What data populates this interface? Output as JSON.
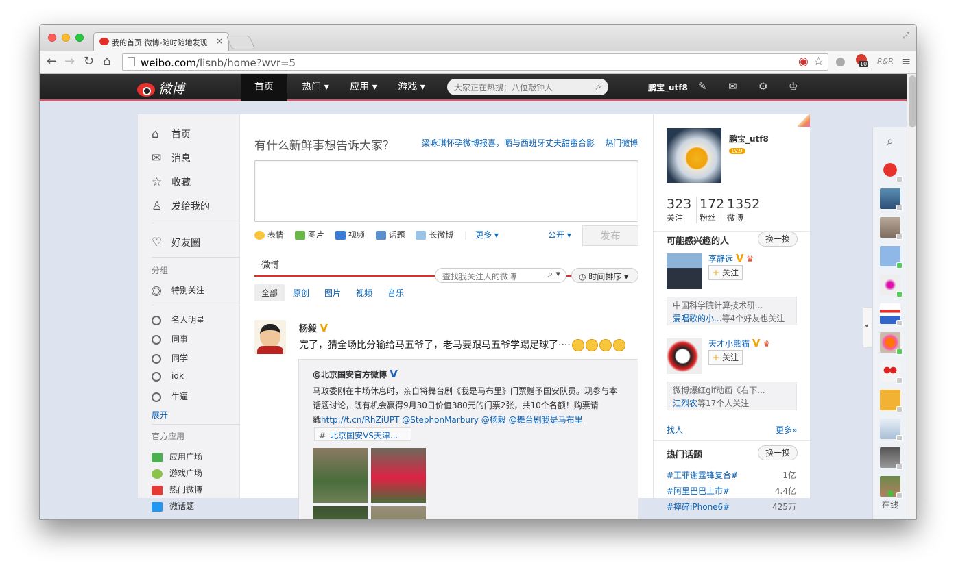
{
  "browser": {
    "tab_title": "我的首页 微博-随时随地发现",
    "tab_close": "×",
    "url_host": "weibo.com",
    "url_rest": "/lisnb/home?wvr=5",
    "ext_badge_count": "10",
    "ext_label": "R&R"
  },
  "topnav": {
    "logo_text": "微博",
    "items": [
      "首页",
      "热门 ▾",
      "应用 ▾",
      "游戏 ▾"
    ],
    "search_placeholder": "大家正在热搜：八位敲钟人",
    "username": "鹏宝_utf8"
  },
  "left_nav": {
    "main": [
      "首页",
      "消息",
      "收藏",
      "发给我的"
    ],
    "circle": "好友圈",
    "group_header": "分组",
    "special": "特别关注",
    "groups": [
      "名人明星",
      "同事",
      "同学",
      "idk",
      "牛逼"
    ],
    "expand": "展开",
    "apps_header": "官方应用",
    "apps": [
      "应用广场",
      "游戏广场",
      "热门微博",
      "微话题"
    ]
  },
  "composer": {
    "prompt": "有什么新鲜事想告诉大家？",
    "link_1": "梁咏琪怀孕微博报喜，晒与西班牙丈夫甜蜜合影",
    "link_2": "热门微博",
    "tools": [
      "表情",
      "图片",
      "视频",
      "话题",
      "长微博"
    ],
    "more": "更多 ▾",
    "visibility": "公开 ▾",
    "publish": "发布"
  },
  "feed": {
    "tab": "微博",
    "search_placeholder": "查找我关注人的微博",
    "sort": "时间排序",
    "filters": [
      "全部",
      "原创",
      "图片",
      "视频",
      "音乐"
    ]
  },
  "post": {
    "author": "杨毅",
    "text": "完了，猜全场比分输给马五爷了，老马要跟马五爷学踢足球了····",
    "repost_author": "@北京国安官方微博",
    "repost_text_1": "马政委刚在中场休息时，亲自将舞台剧《我是马布里》门票赠予国安队员。现参与本",
    "repost_text_2": "话题讨论，既有机会赢得9月30日价值380元的门票2张，共10个名额！购票请",
    "repost_text_3_prefix": "戳",
    "repost_links": "http://t.cn/RhZiUPT @StephonMarbury @杨毅 @舞台剧我是马布里",
    "hashtag": "北京国安VS天津...",
    "hashtag_sign": "#"
  },
  "profile": {
    "name": "鹏宝_utf8",
    "level": "LV.9",
    "stats": [
      {
        "num": "323",
        "label": "关注"
      },
      {
        "num": "172",
        "label": "粉丝"
      },
      {
        "num": "1352",
        "label": "微博"
      }
    ]
  },
  "suggest": {
    "title": "可能感兴趣的人",
    "swap": "换一换",
    "follow": "关注",
    "people": [
      {
        "name": "李静远",
        "desc": "中国科学院计算技术研...",
        "mutual_link": "爱唱歌的小...",
        "mutual_rest": "等4个好友也关注"
      },
      {
        "name": "天才小熊猫",
        "desc": "微博爆红gif动画《右下...",
        "mutual_link": "江烈农",
        "mutual_rest": "等17个人关注"
      }
    ],
    "find": "找人",
    "more": "更多»"
  },
  "topics": {
    "title": "热门话题",
    "swap": "换一换",
    "items": [
      {
        "name": "#王菲谢霆锋复合#",
        "count": "1亿"
      },
      {
        "name": "#阿里巴巴上市#",
        "count": "4.4亿"
      },
      {
        "name": "#摔碎iPhone6#",
        "count": "425万"
      }
    ]
  },
  "chat_sidebar": {
    "online": "在线"
  }
}
